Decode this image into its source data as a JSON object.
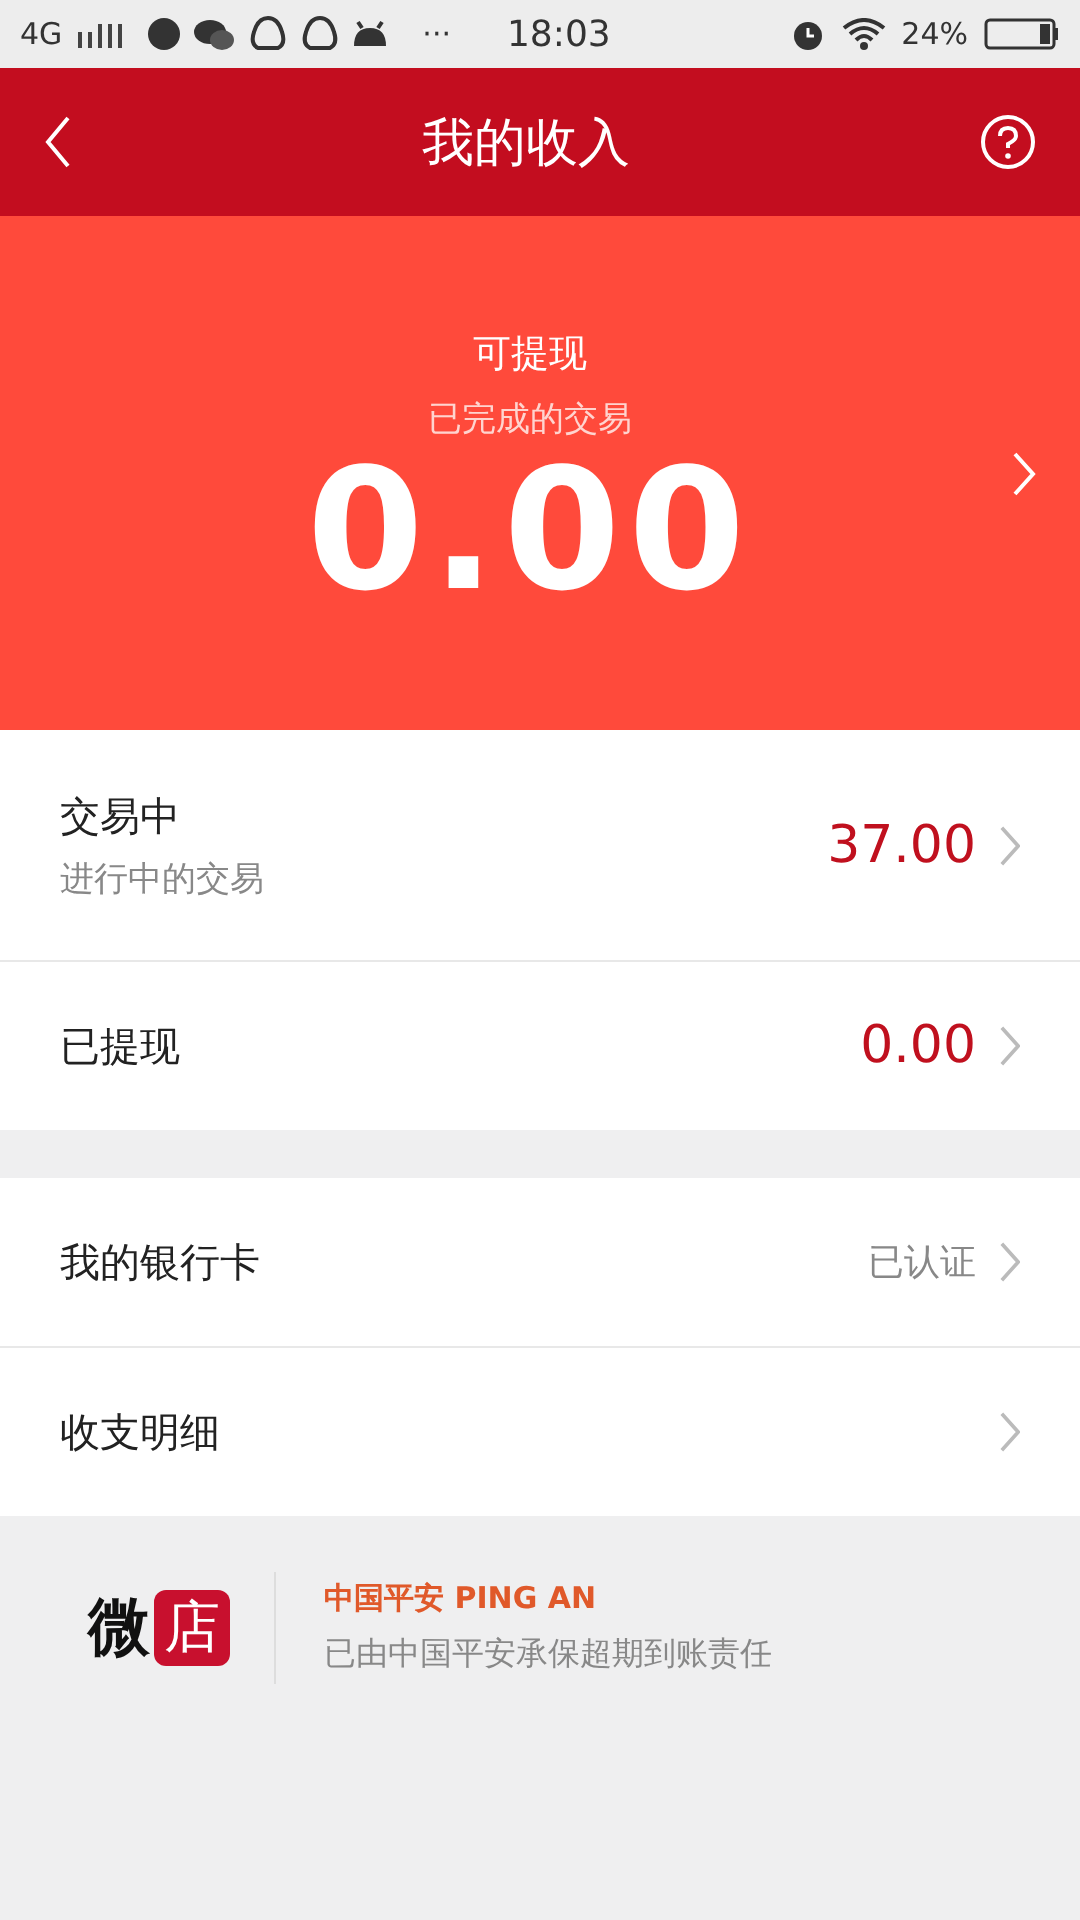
{
  "status_bar": {
    "network": "4G",
    "more": "···",
    "time": "18:03",
    "battery": "24%"
  },
  "header": {
    "title": "我的收入"
  },
  "hero": {
    "label": "可提现",
    "sublabel": "已完成的交易",
    "amount": "0.00"
  },
  "sections": [
    {
      "rows": [
        {
          "kind": "amount",
          "title": "交易中",
          "subtitle": "进行中的交易",
          "value": "37.00"
        },
        {
          "kind": "amount",
          "title": "已提现",
          "value": "0.00"
        }
      ]
    },
    {
      "rows": [
        {
          "kind": "status",
          "title": "我的银行卡",
          "value": "已认证"
        },
        {
          "title": "收支明细"
        }
      ]
    }
  ],
  "footer": {
    "logo_left": "微",
    "logo_right": "店",
    "brand": "中国平安 PING AN",
    "note": "已由中国平安承保超期到账责任"
  }
}
